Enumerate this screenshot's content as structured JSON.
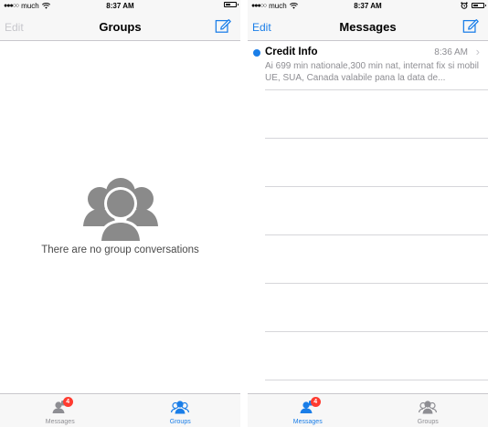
{
  "colors": {
    "accent": "#1a7ee8",
    "badge": "#ff3b30",
    "icon_gray": "#8e8e93",
    "empty_icon": "#8a8a8a"
  },
  "left_screen": {
    "status": {
      "carrier": "much",
      "time": "8:37 AM"
    },
    "nav": {
      "edit_label": "Edit",
      "title": "Groups",
      "compose_icon": "compose-icon"
    },
    "empty_state": {
      "icon": "group-people-icon",
      "text": "There are no group conversations"
    },
    "tabs": [
      {
        "label": "Messages",
        "badge": "4",
        "icon": "person-chat-icon",
        "active": false
      },
      {
        "label": "Groups",
        "icon": "group-icon",
        "active": true
      }
    ]
  },
  "right_screen": {
    "status": {
      "carrier": "much",
      "time": "8:37 AM"
    },
    "nav": {
      "edit_label": "Edit",
      "title": "Messages",
      "compose_icon": "compose-icon"
    },
    "messages": [
      {
        "sender": "Credit Info",
        "time": "8:36 AM",
        "preview": "Ai 699 min nationale,300 min nat, internat fix si mobil UE, SUA, Canada valabile pana la data de...",
        "unread": true
      }
    ],
    "tabs": [
      {
        "label": "Messages",
        "badge": "4",
        "icon": "person-chat-icon",
        "active": true
      },
      {
        "label": "Groups",
        "icon": "group-icon",
        "active": false
      }
    ]
  }
}
